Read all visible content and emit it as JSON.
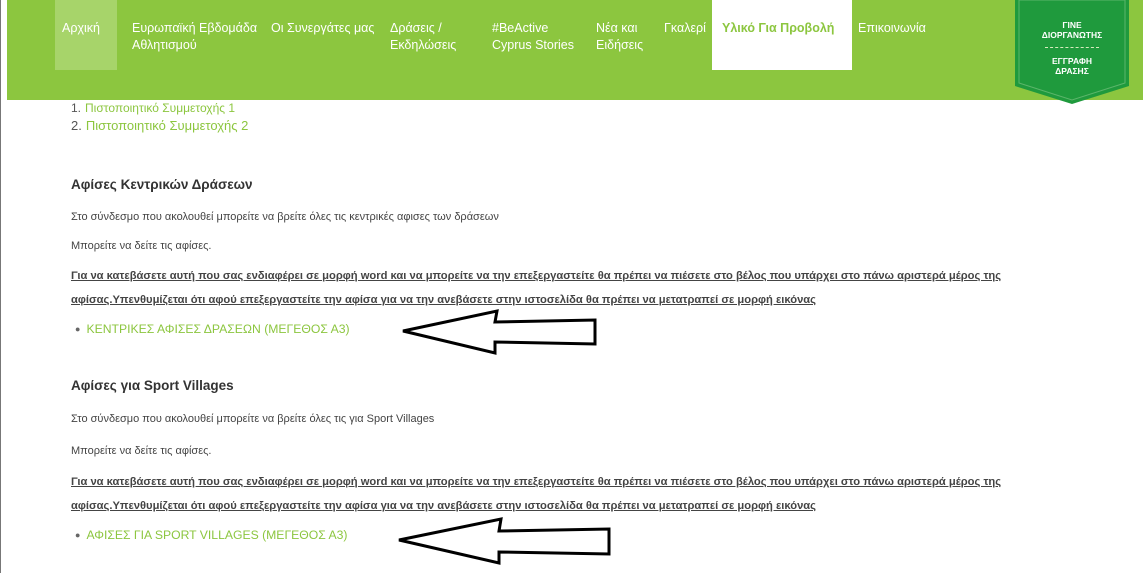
{
  "nav": {
    "items": [
      {
        "line1": "Αρχική",
        "line2": ""
      },
      {
        "line1": "Ευρωπαϊκή Εβδομάδα",
        "line2": "Αθλητισμού"
      },
      {
        "line1": "Οι Συνεργάτες μας",
        "line2": ""
      },
      {
        "line1": "Δράσεις /",
        "line2": "Εκδηλώσεις"
      },
      {
        "line1": "#BeActive",
        "line2": "Cyprus Stories"
      },
      {
        "line1": "Νέα και",
        "line2": "Ειδήσεις"
      },
      {
        "line1": "Γκαλερί",
        "line2": ""
      },
      {
        "line1": "Υλικό Για Προβολή",
        "line2": ""
      },
      {
        "line1": "Επικοινωνία",
        "line2": ""
      }
    ],
    "active_index": 7,
    "badge": {
      "line1a": "ΓΙΝΕ",
      "line1b": "ΔΙΟΡΓΑΝΩΤΗΣ",
      "line2a": "ΕΓΓΡΑΦΗ",
      "line2b": "ΔΡΑΣΗΣ"
    },
    "colors": {
      "brand": "#8cc63f",
      "home_bg": "#a7d46a",
      "badge_bg": "#1f9a3d"
    }
  },
  "certificates": {
    "items": [
      {
        "num": "1.",
        "label": "Πιστοποιητικό Συμμετοχής 1"
      },
      {
        "num": "2.",
        "label": "Πιστοποιητικό Συμμετοχής 2"
      }
    ]
  },
  "section1": {
    "title": "Αφίσες Κεντρικών Δράσεων",
    "text1": "Στο σύνδεσμο που ακολουθεί μπορείτε να βρείτε όλες τις κεντρικές αφισες των δράσεων",
    "text2": "Μπορείτε να δείτε τις αφίσες.",
    "instruction_line1": "Για να κατεβάσετε αυτή που σας ενδιαφέρει σε μορφή word και να μπορείτε να την επεξεργαστείτε θα πρέπει να πιέσετε στο βέλος που υπάρχει στο πάνω αριστερά μέρος της",
    "instruction_line2": "αφίσας.Υπενθυμίζεται ότι αφού επεξεργαστείτε την αφίσα για να την ανεβάσετε στην ιστοσελίδα θα πρέπει να μετατραπεί σε μορφή εικόνας",
    "link": "ΚΕΝΤΡΙΚΕΣ ΑΦΙΣΕΣ ΔΡΑΣΕΩΝ (ΜΕΓΕΘΟΣ Α3)"
  },
  "section2": {
    "title": "Αφίσες για Sport Villages",
    "text1": "Στο σύνδεσμο που ακολουθεί μπορείτε να βρείτε όλες τις για Sport Villages",
    "text2": "Μπορείτε να δείτε τις αφίσες.",
    "instruction_line1": "Για να κατεβάσετε αυτή που σας ενδιαφέρει σε μορφή word και να μπορείτε να την επεξεργαστείτε θα πρέπει να πιέσετε στο βέλος που υπάρχει στο πάνω αριστερά μέρος της",
    "instruction_line2": "αφίσας.Υπενθυμίζεται ότι αφού επεξεργαστείτε την αφίσα για να την ανεβάσετε στην ιστοσελίδα θα πρέπει να μετατραπεί σε μορφή εικόνας",
    "link": "ΑΦΙΣΕΣ ΓΙΑ SPORT VILLAGES (ΜΕΓΕΘΟΣ Α3)"
  }
}
